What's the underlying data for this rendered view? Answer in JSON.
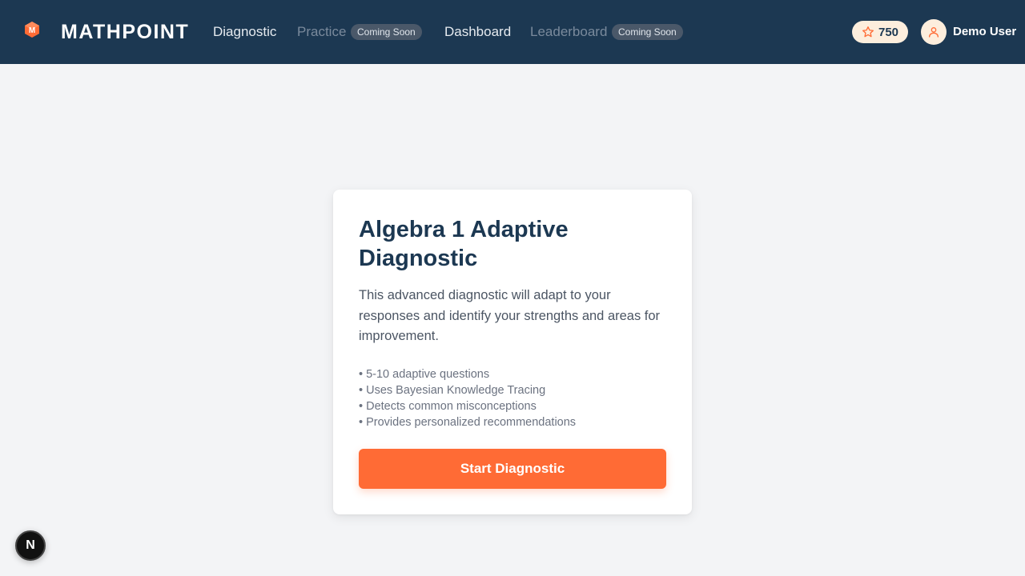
{
  "brand": {
    "name": "MATHPOINT",
    "logo_letter": "M"
  },
  "nav": [
    {
      "label": "Diagnostic",
      "disabled": false
    },
    {
      "label": "Practice",
      "disabled": true,
      "badge": "Coming Soon"
    },
    {
      "label": "Dashboard",
      "disabled": false
    },
    {
      "label": "Leaderboard",
      "disabled": true,
      "badge": "Coming Soon"
    }
  ],
  "user": {
    "points": "750",
    "name": "Demo User"
  },
  "card": {
    "title": "Algebra 1 Adaptive Diagnostic",
    "description": "This advanced diagnostic will adapt to your responses and identify your strengths and areas for improvement.",
    "features": [
      "• 5-10 adaptive questions",
      "• Uses Bayesian Knowledge Tracing",
      "• Detects common misconceptions",
      "• Provides personalized recommendations"
    ],
    "button_label": "Start Diagnostic"
  },
  "dev_badge": {
    "letter": "N"
  },
  "colors": {
    "navbar": "#1c3852",
    "accent": "#ff6b35",
    "background": "#f3f4f6",
    "points_pill": "#fdeedd"
  }
}
